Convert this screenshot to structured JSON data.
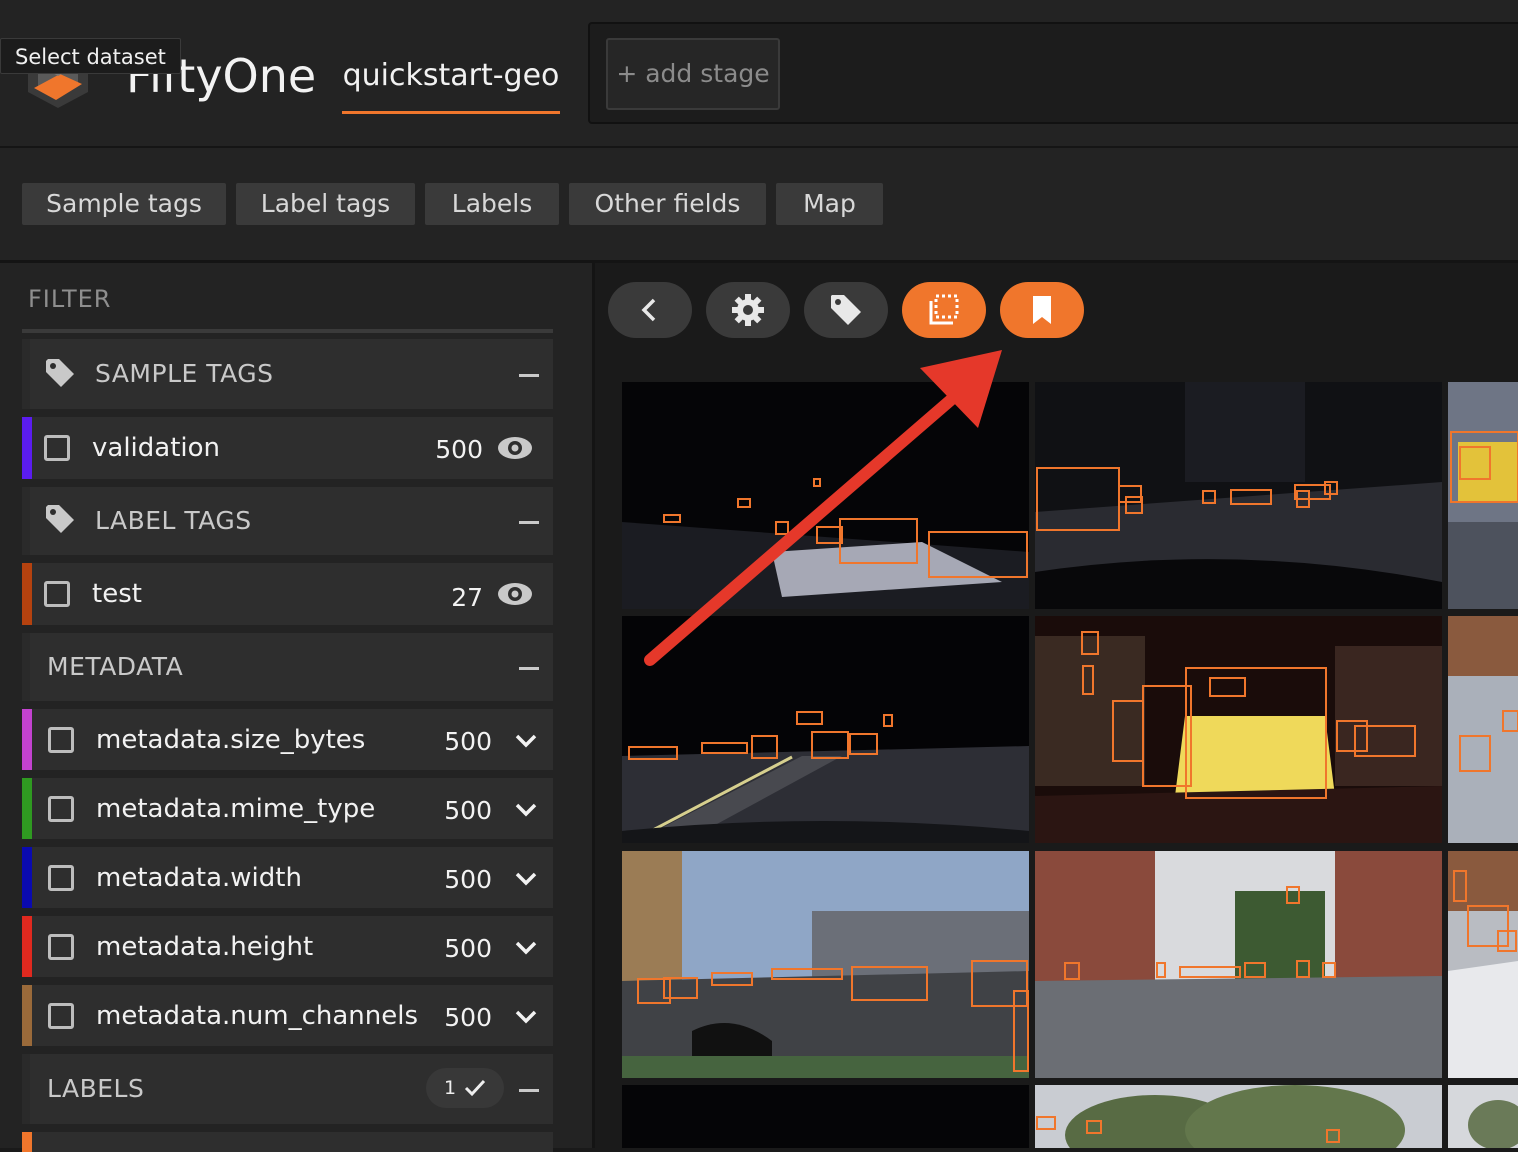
{
  "header": {
    "app_title": "FiftyOne",
    "tooltip": "Select dataset",
    "dataset_name": "quickstart-geo",
    "add_stage": "+ add stage"
  },
  "field_tabs": [
    "Sample tags",
    "Label tags",
    "Labels",
    "Other fields",
    "Map"
  ],
  "sidebar": {
    "filter_title": "FILTER",
    "groups": {
      "sample_tags": "SAMPLE TAGS",
      "label_tags": "LABEL TAGS",
      "metadata": "METADATA",
      "labels": "LABELS"
    },
    "sample_tag_rows": [
      {
        "label": "validation",
        "count": "500",
        "color": "#5b1cf0"
      }
    ],
    "label_tag_rows": [
      {
        "label": "test",
        "count": "27",
        "color": "#b5420f"
      }
    ],
    "metadata_rows": [
      {
        "label": "metadata.size_bytes",
        "count": "500",
        "color": "#c342d0"
      },
      {
        "label": "metadata.mime_type",
        "count": "500",
        "color": "#2f9a21"
      },
      {
        "label": "metadata.width",
        "count": "500",
        "color": "#0a0ab0"
      },
      {
        "label": "metadata.height",
        "count": "500",
        "color": "#e0291f"
      },
      {
        "label": "metadata.num_channels",
        "count": "500",
        "color": "#9a6a3a"
      }
    ],
    "labels_badge": "1"
  },
  "toolbar": {
    "buttons": [
      "back-icon",
      "gear-icon",
      "tag-icon",
      "patches-icon",
      "bookmark-icon"
    ],
    "accent": "#f0762c"
  },
  "grid": {
    "box_color": "#f0762c",
    "tiles": 14
  }
}
